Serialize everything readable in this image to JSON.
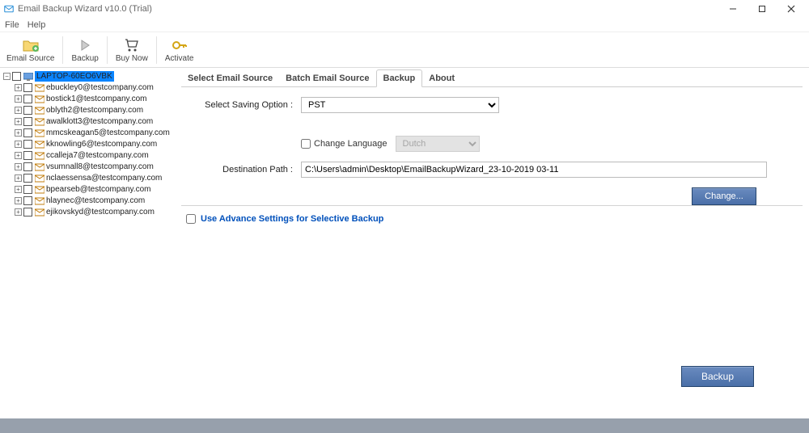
{
  "title": "Email Backup Wizard v10.0 (Trial)",
  "menu": {
    "file": "File",
    "help": "Help"
  },
  "toolbar": {
    "email_source": "Email Source",
    "backup": "Backup",
    "buy_now": "Buy Now",
    "activate": "Activate"
  },
  "tree": {
    "root": "LAPTOP-60EO6VBK",
    "items": [
      "ebuckley0@testcompany.com",
      "bostick1@testcompany.com",
      "oblyth2@testcompany.com",
      "awalklott3@testcompany.com",
      "mmcskeagan5@testcompany.com",
      "kknowling6@testcompany.com",
      "ccalleja7@testcompany.com",
      "vsumnall8@testcompany.com",
      "nclaessensa@testcompany.com",
      "bpearseb@testcompany.com",
      "hlaynec@testcompany.com",
      "ejikovskyd@testcompany.com"
    ]
  },
  "tabs": {
    "select_source": "Select Email Source",
    "batch_source": "Batch Email Source",
    "backup": "Backup",
    "about": "About"
  },
  "form": {
    "saving_option_label": "Select Saving Option :",
    "saving_option_value": "PST",
    "change_language_label": "Change Language",
    "language_value": "Dutch",
    "destination_label": "Destination Path :",
    "destination_value": "C:\\Users\\admin\\Desktop\\EmailBackupWizard_23-10-2019 03-11",
    "change_button": "Change...",
    "advance_label": "Use Advance Settings for Selective Backup",
    "backup_button": "Backup"
  }
}
